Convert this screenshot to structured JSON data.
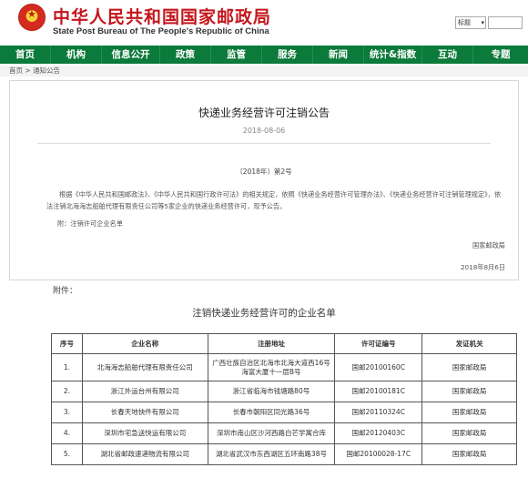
{
  "header": {
    "title": "中华人民共和国国家邮政局",
    "subtitle": "State Post Bureau of The People's Republic of China",
    "search_select_label": "标题"
  },
  "nav": {
    "items": [
      {
        "label": "首页"
      },
      {
        "label": "机构"
      },
      {
        "label": "信息公开"
      },
      {
        "label": "政策"
      },
      {
        "label": "监管"
      },
      {
        "label": "服务"
      },
      {
        "label": "新闻"
      },
      {
        "label": "统计&指数"
      },
      {
        "label": "互动"
      },
      {
        "label": "专题"
      }
    ]
  },
  "breadcrumb": {
    "home": "首页",
    "sep": " > ",
    "current": "通知公告"
  },
  "article": {
    "title": "快递业务经营许可注销公告",
    "date": "2018-08-06",
    "doc_number": "〔2018年〕第2号",
    "body": "根据《中华人民共和国邮政法》、《中华人民共和国行政许可法》的相关规定，依照《快递业务经营许可管理办法》、《快递业务经营许可注销管理规定》，依法注销北海海志船舶代理有限责任公司等5家企业的快递业务经营许可，现予公告。",
    "attachment_note": "附：注销许可企业名单",
    "issuer": "国家邮政局",
    "issue_date": "2018年8月6日"
  },
  "attachment": {
    "label": "附件：",
    "table_title": "注销快递业务经营许可的企业名单",
    "columns": [
      "序号",
      "企业名称",
      "注册地址",
      "许可证编号",
      "发证机关"
    ],
    "rows": [
      [
        "1.",
        "北海海志船舶代理有限责任公司",
        "广西壮族自治区北海市北海大道西16号海富大厦十一层B号",
        "国邮20100160C",
        "国家邮政局"
      ],
      [
        "2.",
        "浙江外运台州有限公司",
        "浙江省临海市钱塘路80号",
        "国邮20100181C",
        "国家邮政局"
      ],
      [
        "3.",
        "长春天地快件有限公司",
        "长春市朝阳区同光路36号",
        "国邮20110324C",
        "国家邮政局"
      ],
      [
        "4.",
        "深圳市宅急送快运有限公司",
        "深圳市南山区沙河西路白芒学寓合库",
        "国邮20120403C",
        "国家邮政局"
      ],
      [
        "5.",
        "湖北省邮政速递物流有限公司",
        "湖北省武汉市东西湖区五环南路38号",
        "国邮20100028-17C",
        "国家邮政局"
      ]
    ]
  },
  "colors": {
    "brand_red": "#c4161c",
    "nav_green": "#0b7a3a"
  }
}
